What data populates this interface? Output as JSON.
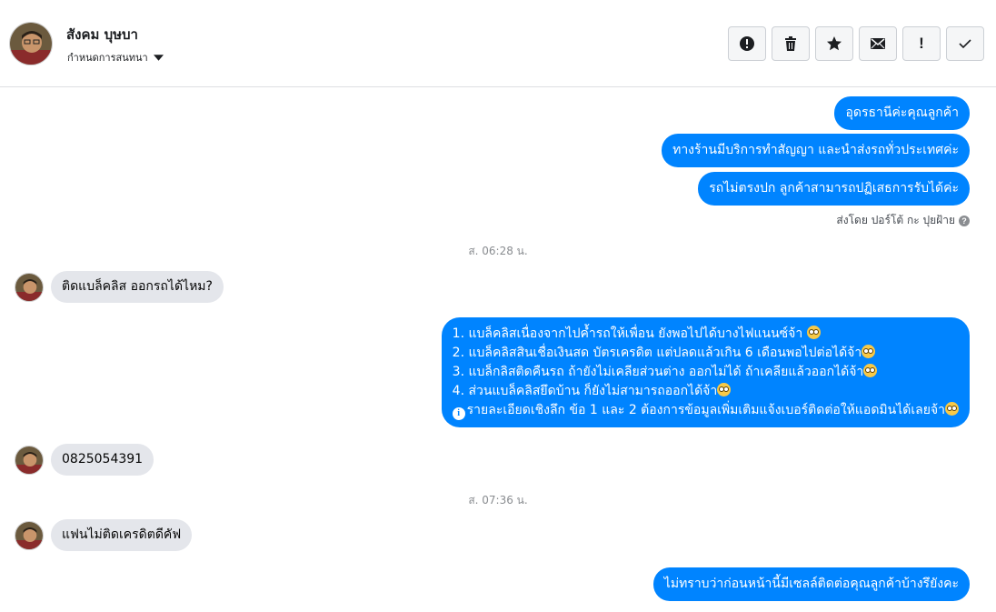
{
  "header": {
    "contact_name": "สังคม บุษบา",
    "assign_label": "กำหนดการสนทนา",
    "toolbar": [
      {
        "name": "mark-spam-button",
        "icon": "alert-circle-icon"
      },
      {
        "name": "delete-button",
        "icon": "trash-icon"
      },
      {
        "name": "star-button",
        "icon": "star-icon"
      },
      {
        "name": "mark-unread-button",
        "icon": "envelope-icon"
      },
      {
        "name": "follow-up-button",
        "icon": "exclamation-icon"
      },
      {
        "name": "mark-done-button",
        "icon": "checkmark-icon"
      }
    ]
  },
  "thread": {
    "outgoing_1": "อุดรธานีค่ะคุณลูกค้า",
    "outgoing_2": "ทางร้านมีบริการทำสัญญา และนำส่งรถทั่วประเทศค่ะ",
    "outgoing_3": "รถไม่ตรงปก ลูกค้าสามารถปฏิเสธการรับได้ค่ะ",
    "sent_by": "ส่งโดย ปอร์โต้ กะ ปุยฝ้าย",
    "timestamp_1": "ส. 06:28 น.",
    "incoming_1": "ติดแบล็คลิส ออกรถได้ไหม?",
    "outgoing_list": {
      "line_1": "1. แบล็คลิสเนื่องจากไปค้ำรถให้เพื่อน ยังพอไปได้บางไฟแนนซ์จ้า ",
      "line_2": "2. แบล็คลิสสินเชื่อเงินสด บัตรเครดิต แต่ปลดแล้วเกิน 6 เดือนพอไปต่อได้จ้า",
      "line_3": "3. แบล็กลิสติดคืนรถ ถ้ายังไม่เคลียส่วนต่าง ออกไม่ได้ ถ้าเคลียแล้วออกได้จ้า",
      "line_4": "4. ส่วนแบล็คลิสยึดบ้าน ก็ยังไม่สามารถออกได้จ้า",
      "line_5": "รายละเอียดเชิงลึก ข้อ 1 และ 2 ต้องการข้อมูลเพิ่มเติมแจ้งเบอร์ติดต่อให้แอดมินได้เลยจ้า"
    },
    "incoming_2": "0825054391",
    "timestamp_2": "ส. 07:36 น.",
    "incoming_3": "แฟนไม่ติดเครดิตดีคัฟ",
    "outgoing_4": "ไม่ทราบว่าก่อนหน้านี้มีเซลล์ติดต่อคุณลูกค้าบ้างรึยังคะ"
  },
  "colors": {
    "outgoing_bubble": "#0084ff",
    "incoming_bubble": "#e4e6eb",
    "timestamp": "#8a8d91"
  }
}
